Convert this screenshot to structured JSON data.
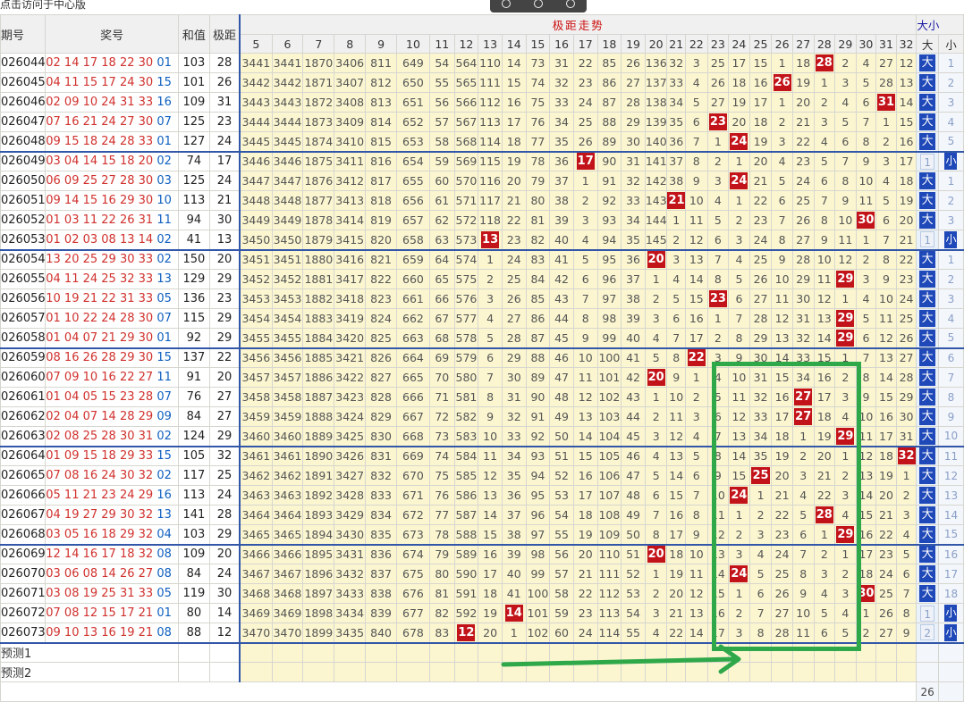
{
  "hint_text": "点击访问于中心版",
  "zoom_icons": [
    "zoom-in-icon",
    "zoom-out-icon",
    "zoom-fit-icon"
  ],
  "headers": {
    "issue": "期号",
    "prize": "奖号",
    "sum": "和值",
    "span": "极距",
    "trend": "极距走势",
    "dx": "大小",
    "dx_big": "大",
    "dx_small": "小"
  },
  "span_columns": [
    "5",
    "6",
    "7",
    "8",
    "9",
    "10",
    "11",
    "12",
    "13",
    "14",
    "15",
    "16",
    "17",
    "18",
    "19",
    "20",
    "21",
    "22",
    "23",
    "24",
    "25",
    "26",
    "27",
    "28",
    "29",
    "30",
    "31",
    "32"
  ],
  "rows": [
    {
      "issue": "026044",
      "red": "02 14 17 18 22 30",
      "blue": "01",
      "sum": "103",
      "span": "28",
      "cells": [
        "3441",
        "3441",
        "1870",
        "3406",
        "811",
        "649",
        "54",
        "564",
        "110",
        "14",
        "73",
        "31",
        "22",
        "85",
        "26",
        "136",
        "32",
        "3",
        "25",
        "17",
        "15",
        "1",
        "18",
        "28",
        "2",
        "4",
        "27",
        "12"
      ],
      "dx": "大",
      "x": "1"
    },
    {
      "issue": "026045",
      "red": "04 11 15 17 24 30",
      "blue": "15",
      "sum": "101",
      "span": "26",
      "cells": [
        "3442",
        "3442",
        "1871",
        "3407",
        "812",
        "650",
        "55",
        "565",
        "111",
        "15",
        "74",
        "32",
        "23",
        "86",
        "27",
        "137",
        "33",
        "4",
        "26",
        "18",
        "16",
        "26",
        "19",
        "1",
        "3",
        "5",
        "28",
        "13"
      ],
      "dx": "大",
      "x": "2"
    },
    {
      "issue": "026046",
      "red": "02 09 10 24 31 33",
      "blue": "16",
      "sum": "109",
      "span": "31",
      "cells": [
        "3443",
        "3443",
        "1872",
        "3408",
        "813",
        "651",
        "56",
        "566",
        "112",
        "16",
        "75",
        "33",
        "24",
        "87",
        "28",
        "138",
        "34",
        "5",
        "27",
        "19",
        "17",
        "1",
        "20",
        "2",
        "4",
        "6",
        "31",
        "14"
      ],
      "dx": "大",
      "x": "3"
    },
    {
      "issue": "026047",
      "red": "07 16 21 24 27 30",
      "blue": "07",
      "sum": "125",
      "span": "23",
      "cells": [
        "3444",
        "3444",
        "1873",
        "3409",
        "814",
        "652",
        "57",
        "567",
        "113",
        "17",
        "76",
        "34",
        "25",
        "88",
        "29",
        "139",
        "35",
        "6",
        "23",
        "20",
        "18",
        "2",
        "21",
        "3",
        "5",
        "7",
        "1",
        "15"
      ],
      "dx": "大",
      "x": "4"
    },
    {
      "issue": "026048",
      "red": "09 15 18 24 28 33",
      "blue": "01",
      "sum": "127",
      "span": "24",
      "cells": [
        "3445",
        "3445",
        "1874",
        "3410",
        "815",
        "653",
        "58",
        "568",
        "114",
        "18",
        "77",
        "35",
        "26",
        "89",
        "30",
        "140",
        "36",
        "7",
        "1",
        "24",
        "19",
        "3",
        "22",
        "4",
        "6",
        "8",
        "2",
        "16"
      ],
      "dx": "大",
      "x": "5"
    },
    {
      "issue": "026049",
      "red": "03 04 14 15 18 20",
      "blue": "02",
      "sum": "74",
      "span": "17",
      "cells": [
        "3446",
        "3446",
        "1875",
        "3411",
        "816",
        "654",
        "59",
        "569",
        "115",
        "19",
        "78",
        "36",
        "17",
        "90",
        "31",
        "141",
        "37",
        "8",
        "2",
        "1",
        "20",
        "4",
        "23",
        "5",
        "7",
        "9",
        "3",
        "17"
      ],
      "dx": "1",
      "x": "小"
    },
    {
      "issue": "026050",
      "red": "06 09 25 27 28 30",
      "blue": "03",
      "sum": "125",
      "span": "24",
      "cells": [
        "3447",
        "3447",
        "1876",
        "3412",
        "817",
        "655",
        "60",
        "570",
        "116",
        "20",
        "79",
        "37",
        "1",
        "91",
        "32",
        "142",
        "38",
        "9",
        "3",
        "24",
        "21",
        "5",
        "24",
        "6",
        "8",
        "10",
        "4",
        "18"
      ],
      "dx": "大",
      "x": "1"
    },
    {
      "issue": "026051",
      "red": "09 14 15 16 29 30",
      "blue": "10",
      "sum": "113",
      "span": "21",
      "cells": [
        "3448",
        "3448",
        "1877",
        "3413",
        "818",
        "656",
        "61",
        "571",
        "117",
        "21",
        "80",
        "38",
        "2",
        "92",
        "33",
        "143",
        "21",
        "10",
        "4",
        "1",
        "22",
        "6",
        "25",
        "7",
        "9",
        "11",
        "5",
        "19"
      ],
      "dx": "大",
      "x": "2"
    },
    {
      "issue": "026052",
      "red": "01 03 11 22 26 31",
      "blue": "11",
      "sum": "94",
      "span": "30",
      "cells": [
        "3449",
        "3449",
        "1878",
        "3414",
        "819",
        "657",
        "62",
        "572",
        "118",
        "22",
        "81",
        "39",
        "3",
        "93",
        "34",
        "144",
        "1",
        "11",
        "5",
        "2",
        "23",
        "7",
        "26",
        "8",
        "10",
        "30",
        "6",
        "20"
      ],
      "dx": "大",
      "x": "3"
    },
    {
      "issue": "026053",
      "red": "01 02 03 08 13 14",
      "blue": "02",
      "sum": "41",
      "span": "13",
      "cells": [
        "3450",
        "3450",
        "1879",
        "3415",
        "820",
        "658",
        "63",
        "573",
        "13",
        "23",
        "82",
        "40",
        "4",
        "94",
        "35",
        "145",
        "2",
        "12",
        "6",
        "3",
        "24",
        "8",
        "27",
        "9",
        "11",
        "1",
        "7",
        "21"
      ],
      "dx": "1",
      "x": "小"
    },
    {
      "issue": "026054",
      "red": "13 20 25 29 30 33",
      "blue": "02",
      "sum": "150",
      "span": "20",
      "cells": [
        "3451",
        "3451",
        "1880",
        "3416",
        "821",
        "659",
        "64",
        "574",
        "1",
        "24",
        "83",
        "41",
        "5",
        "95",
        "36",
        "20",
        "3",
        "13",
        "7",
        "4",
        "25",
        "9",
        "28",
        "10",
        "12",
        "2",
        "8",
        "22"
      ],
      "dx": "大",
      "x": "1"
    },
    {
      "issue": "026055",
      "red": "04 11 24 25 32 33",
      "blue": "13",
      "sum": "129",
      "span": "29",
      "cells": [
        "3452",
        "3452",
        "1881",
        "3417",
        "822",
        "660",
        "65",
        "575",
        "2",
        "25",
        "84",
        "42",
        "6",
        "96",
        "37",
        "1",
        "4",
        "14",
        "8",
        "5",
        "26",
        "10",
        "29",
        "11",
        "29",
        "3",
        "9",
        "23"
      ],
      "dx": "大",
      "x": "2"
    },
    {
      "issue": "026056",
      "red": "10 19 21 22 31 33",
      "blue": "05",
      "sum": "136",
      "span": "23",
      "cells": [
        "3453",
        "3453",
        "1882",
        "3418",
        "823",
        "661",
        "66",
        "576",
        "3",
        "26",
        "85",
        "43",
        "7",
        "97",
        "38",
        "2",
        "5",
        "15",
        "23",
        "6",
        "27",
        "11",
        "30",
        "12",
        "1",
        "4",
        "10",
        "24"
      ],
      "dx": "大",
      "x": "3"
    },
    {
      "issue": "026057",
      "red": "01 10 22 24 28 30",
      "blue": "07",
      "sum": "115",
      "span": "29",
      "cells": [
        "3454",
        "3454",
        "1883",
        "3419",
        "824",
        "662",
        "67",
        "577",
        "4",
        "27",
        "86",
        "44",
        "8",
        "98",
        "39",
        "3",
        "6",
        "16",
        "1",
        "7",
        "28",
        "12",
        "31",
        "13",
        "29",
        "5",
        "11",
        "25"
      ],
      "dx": "大",
      "x": "4"
    },
    {
      "issue": "026058",
      "red": "01 04 07 21 29 30",
      "blue": "01",
      "sum": "92",
      "span": "29",
      "cells": [
        "3455",
        "3455",
        "1884",
        "3420",
        "825",
        "663",
        "68",
        "578",
        "5",
        "28",
        "87",
        "45",
        "9",
        "99",
        "40",
        "4",
        "7",
        "17",
        "2",
        "8",
        "29",
        "13",
        "32",
        "14",
        "29",
        "6",
        "12",
        "26"
      ],
      "dx": "大",
      "x": "5"
    },
    {
      "issue": "026059",
      "red": "08 16 26 28 29 30",
      "blue": "15",
      "sum": "137",
      "span": "22",
      "cells": [
        "3456",
        "3456",
        "1885",
        "3421",
        "826",
        "664",
        "69",
        "579",
        "6",
        "29",
        "88",
        "46",
        "10",
        "100",
        "41",
        "5",
        "8",
        "22",
        "3",
        "9",
        "30",
        "14",
        "33",
        "15",
        "1",
        "7",
        "13",
        "27"
      ],
      "dx": "大",
      "x": "6"
    },
    {
      "issue": "026060",
      "red": "07 09 10 16 22 27",
      "blue": "11",
      "sum": "91",
      "span": "20",
      "cells": [
        "3457",
        "3457",
        "1886",
        "3422",
        "827",
        "665",
        "70",
        "580",
        "7",
        "30",
        "89",
        "47",
        "11",
        "101",
        "42",
        "20",
        "9",
        "1",
        "4",
        "10",
        "31",
        "15",
        "34",
        "16",
        "2",
        "8",
        "14",
        "28"
      ],
      "dx": "大",
      "x": "7"
    },
    {
      "issue": "026061",
      "red": "01 04 05 15 23 28",
      "blue": "07",
      "sum": "76",
      "span": "27",
      "cells": [
        "3458",
        "3458",
        "1887",
        "3423",
        "828",
        "666",
        "71",
        "581",
        "8",
        "31",
        "90",
        "48",
        "12",
        "102",
        "43",
        "1",
        "10",
        "2",
        "5",
        "11",
        "32",
        "16",
        "27",
        "17",
        "3",
        "9",
        "15",
        "29"
      ],
      "dx": "大",
      "x": "8"
    },
    {
      "issue": "026062",
      "red": "02 04 07 14 28 29",
      "blue": "09",
      "sum": "84",
      "span": "27",
      "cells": [
        "3459",
        "3459",
        "1888",
        "3424",
        "829",
        "667",
        "72",
        "582",
        "9",
        "32",
        "91",
        "49",
        "13",
        "103",
        "44",
        "2",
        "11",
        "3",
        "6",
        "12",
        "33",
        "17",
        "27",
        "18",
        "4",
        "10",
        "16",
        "30"
      ],
      "dx": "大",
      "x": "9"
    },
    {
      "issue": "026063",
      "red": "02 08 25 28 30 31",
      "blue": "02",
      "sum": "124",
      "span": "29",
      "cells": [
        "3460",
        "3460",
        "1889",
        "3425",
        "830",
        "668",
        "73",
        "583",
        "10",
        "33",
        "92",
        "50",
        "14",
        "104",
        "45",
        "3",
        "12",
        "4",
        "7",
        "13",
        "34",
        "18",
        "1",
        "19",
        "29",
        "11",
        "17",
        "31"
      ],
      "dx": "大",
      "x": "10"
    },
    {
      "issue": "026064",
      "red": "01 09 15 18 29 33",
      "blue": "15",
      "sum": "105",
      "span": "32",
      "cells": [
        "3461",
        "3461",
        "1890",
        "3426",
        "831",
        "669",
        "74",
        "584",
        "11",
        "34",
        "93",
        "51",
        "15",
        "105",
        "46",
        "4",
        "13",
        "5",
        "8",
        "14",
        "35",
        "19",
        "2",
        "20",
        "1",
        "12",
        "18",
        "32"
      ],
      "dx": "大",
      "x": "11"
    },
    {
      "issue": "026065",
      "red": "07 08 16 24 30 32",
      "blue": "02",
      "sum": "117",
      "span": "25",
      "cells": [
        "3462",
        "3462",
        "1891",
        "3427",
        "832",
        "670",
        "75",
        "585",
        "12",
        "35",
        "94",
        "52",
        "16",
        "106",
        "47",
        "5",
        "14",
        "6",
        "9",
        "15",
        "25",
        "20",
        "3",
        "21",
        "2",
        "13",
        "19",
        "1"
      ],
      "dx": "大",
      "x": "12"
    },
    {
      "issue": "026066",
      "red": "05 11 21 23 24 29",
      "blue": "16",
      "sum": "113",
      "span": "24",
      "cells": [
        "3463",
        "3463",
        "1892",
        "3428",
        "833",
        "671",
        "76",
        "586",
        "13",
        "36",
        "95",
        "53",
        "17",
        "107",
        "48",
        "6",
        "15",
        "7",
        "10",
        "24",
        "1",
        "21",
        "4",
        "22",
        "3",
        "14",
        "20",
        "2"
      ],
      "dx": "大",
      "x": "13"
    },
    {
      "issue": "026067",
      "red": "04 19 27 29 30 32",
      "blue": "13",
      "sum": "141",
      "span": "28",
      "cells": [
        "3464",
        "3464",
        "1893",
        "3429",
        "834",
        "672",
        "77",
        "587",
        "14",
        "37",
        "96",
        "54",
        "18",
        "108",
        "49",
        "7",
        "16",
        "8",
        "11",
        "1",
        "2",
        "22",
        "5",
        "28",
        "4",
        "15",
        "21",
        "3"
      ],
      "dx": "大",
      "x": "14"
    },
    {
      "issue": "026068",
      "red": "03 05 16 18 29 32",
      "blue": "04",
      "sum": "103",
      "span": "29",
      "cells": [
        "3465",
        "3465",
        "1894",
        "3430",
        "835",
        "673",
        "78",
        "588",
        "15",
        "38",
        "97",
        "55",
        "19",
        "109",
        "50",
        "8",
        "17",
        "9",
        "12",
        "2",
        "3",
        "23",
        "6",
        "1",
        "29",
        "16",
        "22",
        "4"
      ],
      "dx": "大",
      "x": "15"
    },
    {
      "issue": "026069",
      "red": "12 14 16 17 18 32",
      "blue": "08",
      "sum": "109",
      "span": "20",
      "cells": [
        "3466",
        "3466",
        "1895",
        "3431",
        "836",
        "674",
        "79",
        "589",
        "16",
        "39",
        "98",
        "56",
        "20",
        "110",
        "51",
        "20",
        "18",
        "10",
        "13",
        "3",
        "4",
        "24",
        "7",
        "2",
        "1",
        "17",
        "23",
        "5"
      ],
      "dx": "大",
      "x": "16"
    },
    {
      "issue": "026070",
      "red": "03 06 08 14 26 27",
      "blue": "08",
      "sum": "84",
      "span": "24",
      "cells": [
        "3467",
        "3467",
        "1896",
        "3432",
        "837",
        "675",
        "80",
        "590",
        "17",
        "40",
        "99",
        "57",
        "21",
        "111",
        "52",
        "1",
        "19",
        "11",
        "14",
        "24",
        "5",
        "25",
        "8",
        "3",
        "2",
        "18",
        "24",
        "6"
      ],
      "dx": "大",
      "x": "17"
    },
    {
      "issue": "026071",
      "red": "03 08 19 25 31 33",
      "blue": "05",
      "sum": "119",
      "span": "30",
      "cells": [
        "3468",
        "3468",
        "1897",
        "3433",
        "838",
        "676",
        "81",
        "591",
        "18",
        "41",
        "100",
        "58",
        "22",
        "112",
        "53",
        "2",
        "20",
        "12",
        "15",
        "1",
        "6",
        "26",
        "9",
        "4",
        "3",
        "30",
        "25",
        "7"
      ],
      "dx": "大",
      "x": "18"
    },
    {
      "issue": "026072",
      "red": "07 08 12 15 17 21",
      "blue": "01",
      "sum": "80",
      "span": "14",
      "cells": [
        "3469",
        "3469",
        "1898",
        "3434",
        "839",
        "677",
        "82",
        "592",
        "19",
        "14",
        "101",
        "59",
        "23",
        "113",
        "54",
        "3",
        "21",
        "13",
        "16",
        "2",
        "7",
        "27",
        "10",
        "5",
        "4",
        "1",
        "26",
        "8"
      ],
      "dx": "1",
      "x": "小"
    },
    {
      "issue": "026073",
      "red": "09 10 13 16 19 21",
      "blue": "08",
      "sum": "88",
      "span": "12",
      "cells": [
        "3470",
        "3470",
        "1899",
        "3435",
        "840",
        "678",
        "83",
        "12",
        "20",
        "1",
        "102",
        "60",
        "24",
        "114",
        "55",
        "4",
        "22",
        "14",
        "17",
        "3",
        "8",
        "28",
        "11",
        "6",
        "5",
        "2",
        "27",
        "9"
      ],
      "dx": "2",
      "x": "小"
    }
  ],
  "predict": [
    "预测1",
    "预测2"
  ],
  "bottom_num": "26",
  "colors": {
    "red": "#d0312d",
    "blue": "#1060c0",
    "hit": "#c3131a",
    "cell_bg": "#fbf6d0",
    "dx_big": "#1f48b8",
    "separator": "#3357a8",
    "annotation_green": "#2fa84a"
  }
}
